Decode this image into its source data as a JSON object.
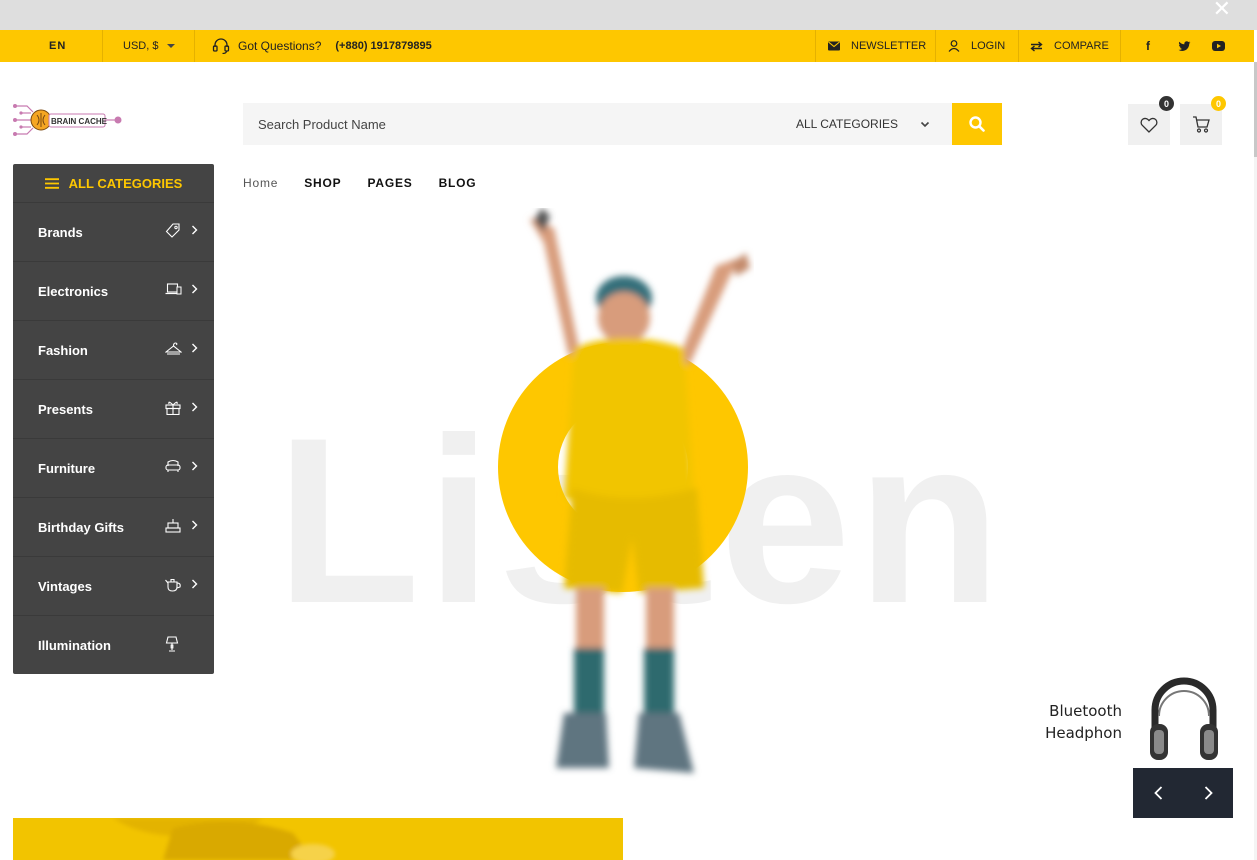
{
  "notice": {
    "close_icon": "close-icon"
  },
  "topbar": {
    "language": "EN",
    "currency": "USD, $",
    "question": "Got Questions?",
    "phone": "(+880) 1917879895",
    "links": [
      {
        "label": "NEWSLETTER",
        "icon": "envelope-icon"
      },
      {
        "label": "LOGIN",
        "icon": "user-icon"
      },
      {
        "label": "COMPARE",
        "icon": "compare-arrows-icon"
      }
    ],
    "social": [
      "f",
      "twitter",
      "youtube"
    ]
  },
  "header": {
    "logo_text": "BRAIN CACHE",
    "search_placeholder": "Search Product Name",
    "category_select": "ALL CATEGORIES",
    "wishlist_count": "0",
    "cart_count": "0"
  },
  "sidebar": {
    "title": "ALL CATEGORIES",
    "items": [
      {
        "label": "Brands",
        "icon": "tag-icon",
        "has_submenu": true
      },
      {
        "label": "Electronics",
        "icon": "laptop-icon",
        "has_submenu": true
      },
      {
        "label": "Fashion",
        "icon": "hanger-icon",
        "has_submenu": true
      },
      {
        "label": "Presents",
        "icon": "gift-icon",
        "has_submenu": true
      },
      {
        "label": "Furniture",
        "icon": "sofa-icon",
        "has_submenu": true
      },
      {
        "label": "Birthday Gifts",
        "icon": "cake-icon",
        "has_submenu": true
      },
      {
        "label": "Vintages",
        "icon": "teapot-icon",
        "has_submenu": true
      },
      {
        "label": "Illumination",
        "icon": "lamp-icon",
        "has_submenu": false
      }
    ]
  },
  "nav": {
    "home": "Home",
    "shop": "SHOP",
    "pages": "PAGES",
    "blog": "BLOG"
  },
  "hero": {
    "background_word": "Listen",
    "product_name": "Bluetooth Headphon"
  },
  "colors": {
    "accent": "#fec700",
    "sidebar": "#444444",
    "dark": "#222833"
  }
}
